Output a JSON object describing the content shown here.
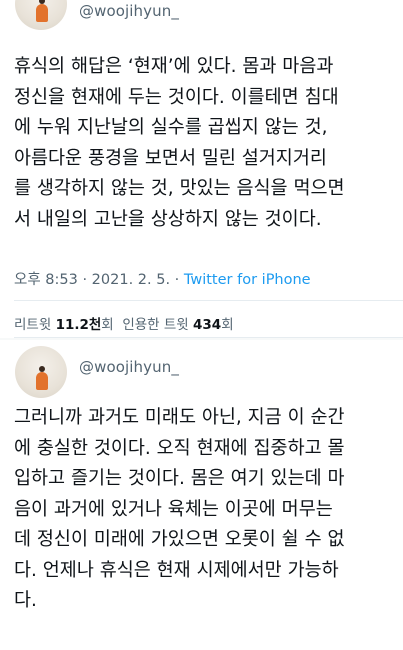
{
  "tweet1": {
    "handle": "@woojihyun_",
    "text": "휴식의 해답은 ‘현재’에 있다. 몸과 마음과\n정신을 현재에 두는 것이다. 이를테면 침대\n에 누워 지난날의 실수를 곱씹지 않는 것,\n아름다운 풍경을 보면서 밀린 설거지거리\n를 생각하지 않는 것, 맛있는 음식을 먹으면\n서 내일의 고난을 상상하지 않는 것이다.",
    "timestamp": "오후 8:53 · 2021. 2. 5. · ",
    "source": "Twitter for iPhone",
    "retweet_label": "리트윗 ",
    "retweet_count": "11.2천",
    "retweet_suffix": "회",
    "quote_label": "인용한 트윗 ",
    "quote_count": "434",
    "quote_suffix": "회"
  },
  "tweet2": {
    "handle": "@woojihyun_",
    "text": "그러니까 과거도 미래도 아닌, 지금 이 순간\n에 충실한 것이다. 오직 현재에 집중하고 몰\n입하고 즐기는 것이다. 몸은 여기 있는데 마\n음이 과거에 있거나 육체는 이곳에 머무는\n데 정신이 미래에 가있으면 오롯이 쉴 수 없\n다. 언제나 휴식은 현재 시제에서만 가능하\n다."
  },
  "colors": {
    "text": "#0f1419",
    "secondary": "#536471",
    "link": "#1d9bf0"
  },
  "icons": {
    "avatar": "profile-photo"
  }
}
